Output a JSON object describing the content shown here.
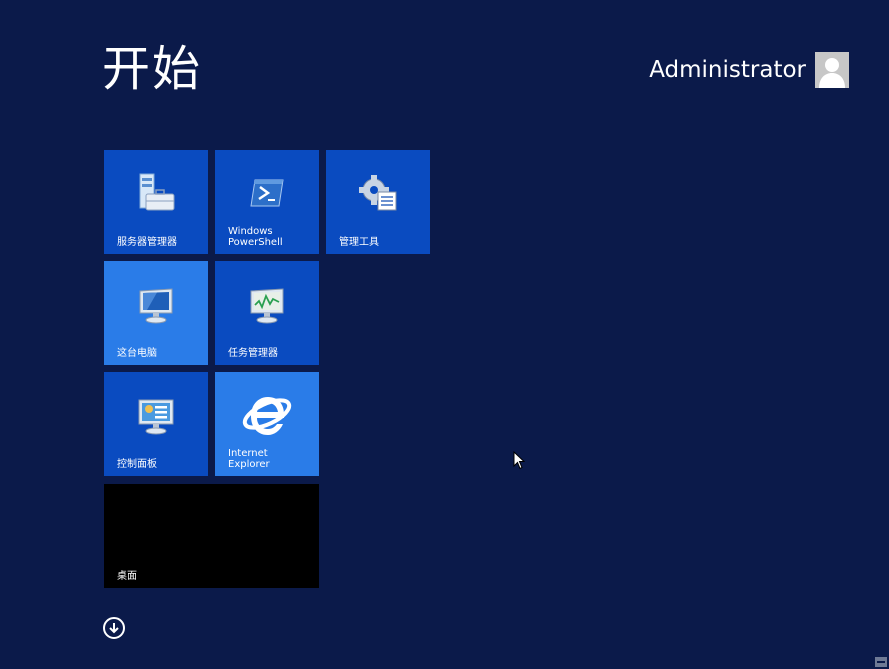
{
  "header": {
    "title": "开始",
    "user_name": "Administrator"
  },
  "tiles": [
    {
      "label": "服务器管理器",
      "icon": "server-manager-icon"
    },
    {
      "label": "Windows\nPowerShell",
      "icon": "powershell-icon"
    },
    {
      "label": "管理工具",
      "icon": "administrative-tools-icon"
    },
    {
      "label": "这台电脑",
      "icon": "this-pc-icon"
    },
    {
      "label": "任务管理器",
      "icon": "task-manager-icon"
    },
    {
      "label": "控制面板",
      "icon": "control-panel-icon"
    },
    {
      "label": "Internet\nExplorer",
      "icon": "internet-explorer-icon"
    },
    {
      "label": "桌面",
      "icon": ""
    }
  ],
  "colors": {
    "background": "#0b1a4a",
    "tile_dark": "#0a4bc0",
    "tile_light": "#2a7ce8",
    "tile_desktop": "#000000"
  }
}
